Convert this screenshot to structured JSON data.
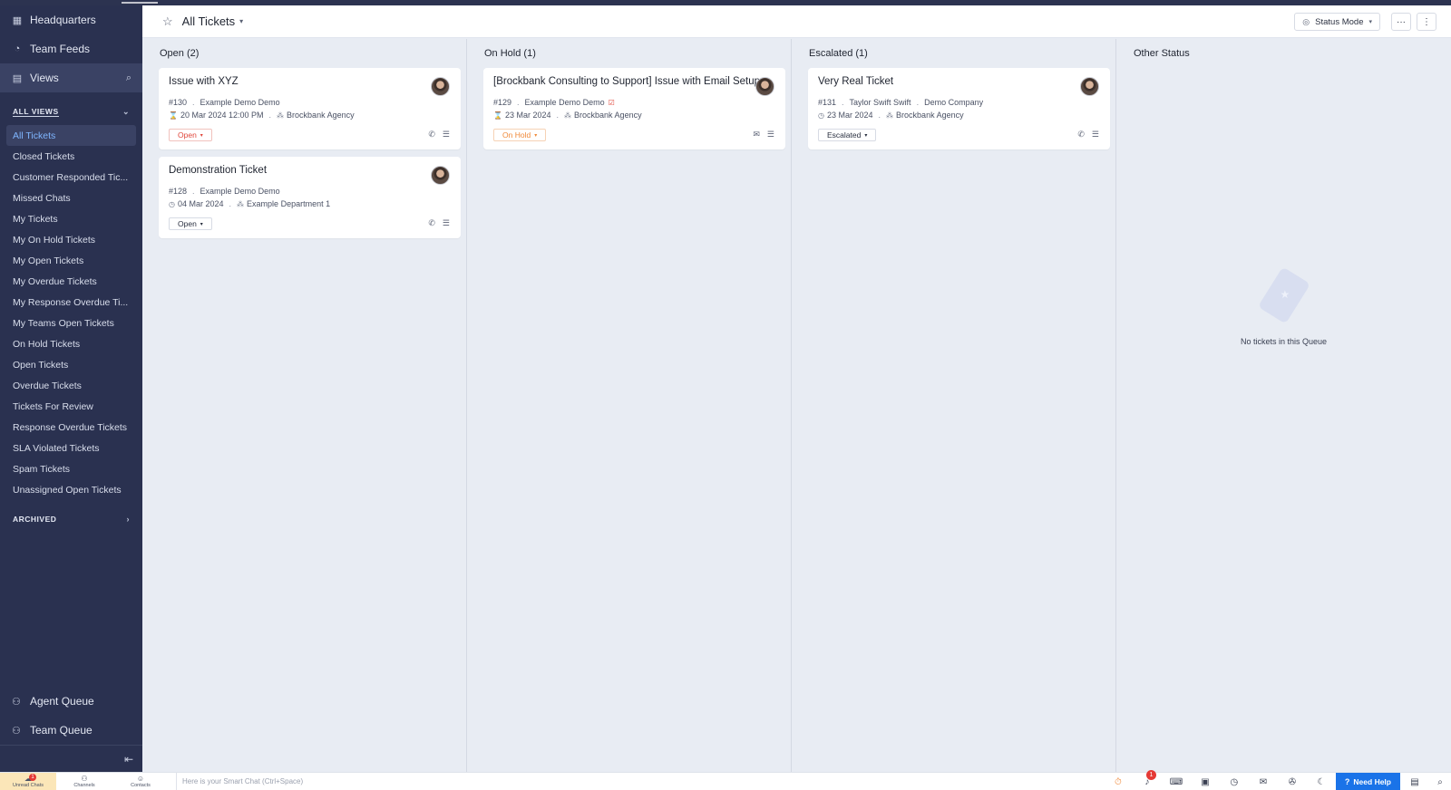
{
  "sidebar": {
    "nav": [
      {
        "label": "Headquarters",
        "icon": "grid-icon"
      },
      {
        "label": "Team Feeds",
        "icon": "feed-icon"
      },
      {
        "label": "Views",
        "icon": "views-icon"
      }
    ],
    "all_views_heading": "ALL VIEWS",
    "views": [
      "All Tickets",
      "Closed Tickets",
      "Customer Responded Tic...",
      "Missed Chats",
      "My Tickets",
      "My On Hold Tickets",
      "My Open Tickets",
      "My Overdue Tickets",
      "My Response Overdue Ti...",
      "My Teams Open Tickets",
      "On Hold Tickets",
      "Open Tickets",
      "Overdue Tickets",
      "Tickets For Review",
      "Response Overdue Tickets",
      "SLA Violated Tickets",
      "Spam Tickets",
      "Unassigned Open Tickets"
    ],
    "archived_heading": "ARCHIVED",
    "queues": [
      {
        "label": "Agent Queue"
      },
      {
        "label": "Team Queue"
      }
    ]
  },
  "header": {
    "title": "All Tickets",
    "status_mode": "Status Mode"
  },
  "columns": [
    {
      "heading": "Open (2)",
      "cards": [
        {
          "title": "Issue with XYZ",
          "number": "#130",
          "contact": "Example Demo Demo",
          "date": "20 Mar 2024 12:00 PM",
          "department": "Brockbank Agency",
          "status": "Open"
        },
        {
          "title": "Demonstration Ticket",
          "number": "#128",
          "contact": "Example Demo Demo",
          "date": "04 Mar 2024",
          "department": "Example Department 1",
          "status": "Open"
        }
      ]
    },
    {
      "heading": "On Hold (1)",
      "cards": [
        {
          "title": "[Brockbank Consulting to Support] Issue with Email Setup",
          "number": "#129",
          "contact": "Example Demo Demo",
          "date": "23 Mar 2024",
          "department": "Brockbank Agency",
          "status": "On Hold"
        }
      ]
    },
    {
      "heading": "Escalated (1)",
      "cards": [
        {
          "title": "Very Real Ticket",
          "number": "#131",
          "contact": "Taylor Swift Swift",
          "company": "Demo Company",
          "date": "23 Mar 2024",
          "department": "Brockbank Agency",
          "status": "Escalated"
        }
      ]
    },
    {
      "heading": "Other Status",
      "empty_text": "No tickets in this Queue"
    }
  ],
  "bottombar": {
    "tabs": [
      "Unread Chats",
      "Channels",
      "Contacts"
    ],
    "unread_badge": "1",
    "smart_chat_placeholder": "Here is your Smart Chat (Ctrl+Space)",
    "notification_badge": "1",
    "need_help": "Need Help"
  },
  "colors": {
    "sidebar_bg": "#2a3150",
    "active_link": "#7fb6ff",
    "open_status": "#e0473c",
    "on_hold_status": "#f08a3a",
    "need_help_bg": "#1a73e8"
  }
}
